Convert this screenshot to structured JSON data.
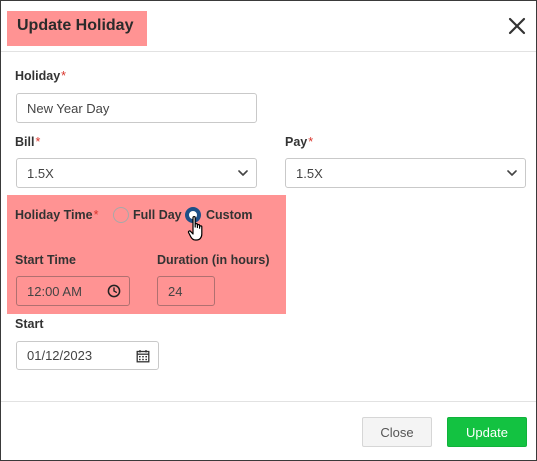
{
  "dialog": {
    "title": "Update Holiday",
    "close_icon": "close-icon"
  },
  "form": {
    "holiday": {
      "label": "Holiday",
      "required": "*",
      "value": "New Year Day"
    },
    "bill": {
      "label": "Bill",
      "required": "*",
      "selected": "1.5X"
    },
    "pay": {
      "label": "Pay",
      "required": "*",
      "selected": "1.5X"
    },
    "holiday_time": {
      "label": "Holiday Time",
      "required": "*",
      "options": [
        "Full Day",
        "Custom"
      ],
      "selected": "Custom"
    },
    "start_time": {
      "label": "Start Time",
      "value": "12:00 AM",
      "icon": "clock-icon"
    },
    "duration": {
      "label": "Duration (in hours)",
      "value": "24"
    },
    "start": {
      "label": "Start",
      "value": "01/12/2023",
      "icon": "calendar-icon"
    }
  },
  "footer": {
    "close_label": "Close",
    "update_label": "Update"
  },
  "colors": {
    "highlight": "#ff9393",
    "update_button": "#13c241",
    "radio_selected": "#1d4f87",
    "required_mark": "#d9342b"
  }
}
